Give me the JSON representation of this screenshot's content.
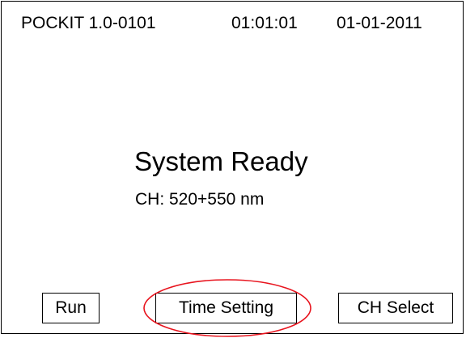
{
  "status_bar": {
    "version": "POCKIT 1.0-0101",
    "time": "01:01:01",
    "date": "01-01-2011"
  },
  "main": {
    "status": "System Ready",
    "channel": "CH: 520+550 nm"
  },
  "soft_keys": {
    "run": "Run",
    "time_setting": "Time Setting",
    "ch_select": "CH Select"
  },
  "colors": {
    "background": "#ffffff",
    "text": "#000000",
    "highlight": "#e8141e"
  }
}
